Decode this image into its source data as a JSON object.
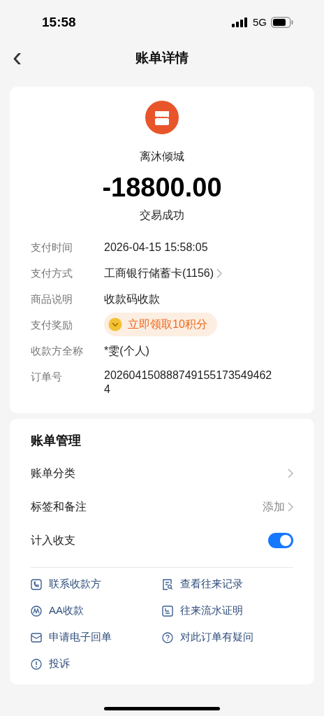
{
  "status_bar": {
    "time": "15:58",
    "network": "5G"
  },
  "nav": {
    "back": "‹",
    "title": "账单详情"
  },
  "summary": {
    "merchant": "离沐倾城",
    "amount": "-18800.00",
    "status": "交易成功"
  },
  "details": [
    {
      "kind": "text",
      "label": "支付时间",
      "value": "2026-04-15 15:58:05"
    },
    {
      "kind": "link",
      "label": "支付方式",
      "value": "工商银行储蓄卡(1156)"
    },
    {
      "kind": "text",
      "label": "商品说明",
      "value": "收款码收款"
    },
    {
      "kind": "reward",
      "label": "支付奖励",
      "value": "立即领取10积分"
    },
    {
      "kind": "text",
      "label": "收款方全称",
      "value": "*雯(个人)"
    },
    {
      "kind": "wrap",
      "label": "订单号",
      "value": "2026041508887491551735494624"
    }
  ],
  "management": {
    "title": "账单管理",
    "rows": [
      {
        "kind": "nav",
        "label": "账单分类"
      },
      {
        "kind": "nav",
        "label": "标签和备注",
        "value": "添加"
      },
      {
        "kind": "toggle",
        "label": "计入收支",
        "on": true
      }
    ]
  },
  "actions": [
    {
      "kind": "phone",
      "label": "联系收款方"
    },
    {
      "kind": "record",
      "label": "查看往来记录"
    },
    {
      "kind": "aa",
      "label": "AA收款"
    },
    {
      "kind": "doc",
      "label": "往来流水证明"
    },
    {
      "kind": "mail",
      "label": "申请电子回单"
    },
    {
      "kind": "question",
      "label": "对此订单有疑问"
    },
    {
      "kind": "alert",
      "label": "投诉"
    }
  ]
}
